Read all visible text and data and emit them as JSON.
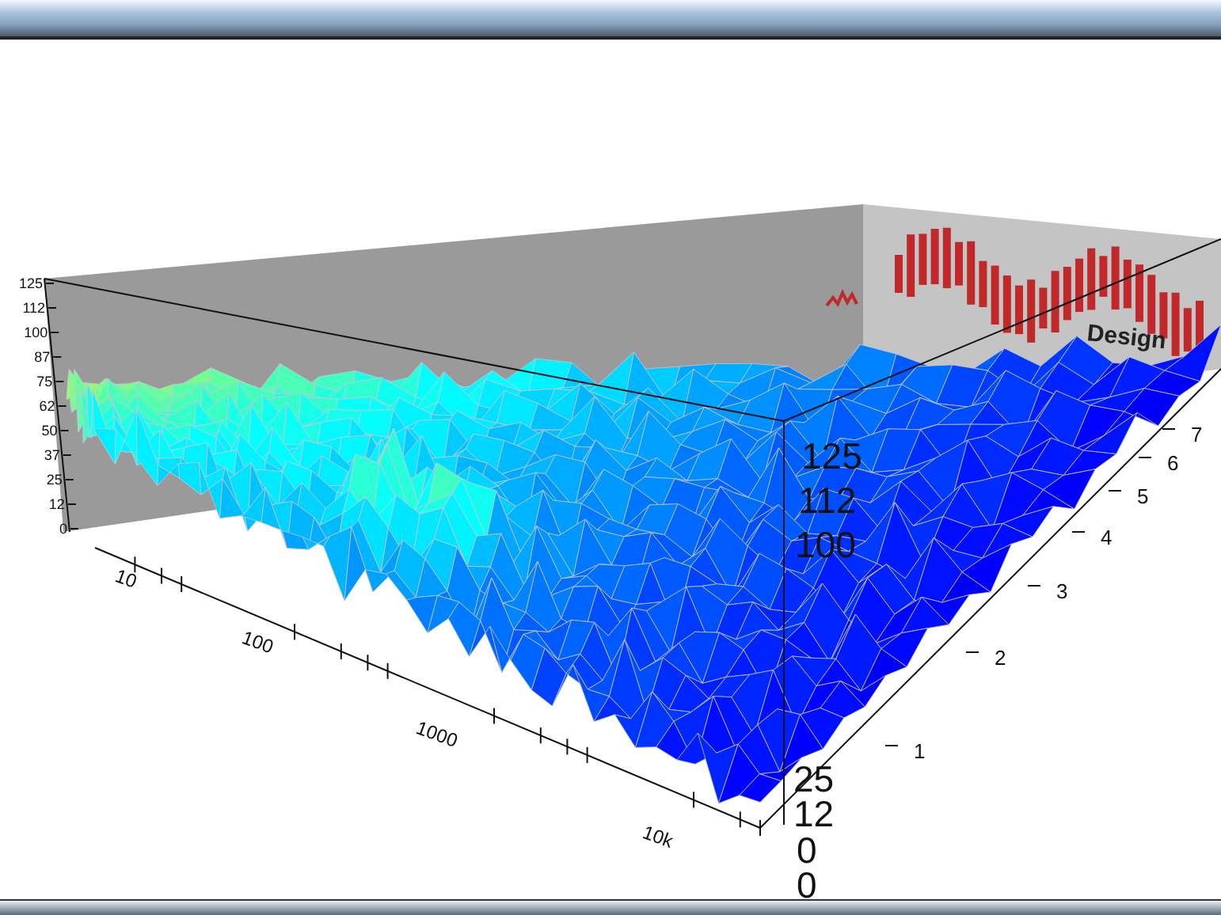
{
  "plot": {
    "wall_label": "Design",
    "z_axis_left": {
      "ticks": [
        "125",
        "112",
        "100",
        "87",
        "75",
        "62",
        "50",
        "37",
        "25",
        "12",
        "0"
      ]
    },
    "z_axis_front": {
      "ticks": [
        "125",
        "112",
        "100",
        "25",
        "12",
        "0",
        "0"
      ]
    },
    "x_axis": {
      "ticks": [
        "10",
        "100",
        "1000",
        "10k"
      ]
    },
    "depth_axis": {
      "ticks": [
        "1",
        "2",
        "3",
        "4",
        "5",
        "6",
        "7"
      ]
    }
  }
}
